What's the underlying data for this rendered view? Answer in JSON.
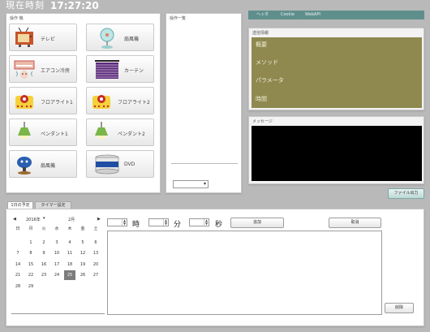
{
  "header": {
    "clock_label": "現在時刻",
    "clock_time": "17:27:20"
  },
  "devices_panel": {
    "title": "操作 機",
    "devices": [
      {
        "label": "テレビ",
        "icon": "tv-icon"
      },
      {
        "label": "扇風機",
        "icon": "fan-icon"
      },
      {
        "label": "エアコン冷房",
        "icon": "aircon-icon"
      },
      {
        "label": "カーテン",
        "icon": "curtain-icon"
      },
      {
        "label": "フロアライト1",
        "icon": "floor-lamp-icon"
      },
      {
        "label": "フロアライト2",
        "icon": "floor-lamp-icon"
      },
      {
        "label": "ペンダント1",
        "icon": "pendant-light-icon"
      },
      {
        "label": "ペンダント2",
        "icon": "pendant-light-icon"
      },
      {
        "label": "扇風機",
        "icon": "fan-robot-icon"
      },
      {
        "label": "DVD",
        "icon": "dvd-icon"
      }
    ]
  },
  "operations_panel": {
    "title": "操作一覧",
    "select_value": ""
  },
  "right_tabs": [
    {
      "label": "ヘッダ"
    },
    {
      "label": "Cookie"
    },
    {
      "label": "WebAPI"
    }
  ],
  "request_panel": {
    "title": "送信情報",
    "lines": [
      "概要",
      "メソッド",
      "パラメータ",
      "時間"
    ]
  },
  "response_panel": {
    "title": "メッセージ"
  },
  "file_output_button": "ファイル出力",
  "bottom_tabs": [
    {
      "label": "1日の予定"
    },
    {
      "label": "タイマー設定"
    }
  ],
  "calendar": {
    "year": "2016年",
    "month": "2月",
    "weekdays": [
      "日",
      "月",
      "火",
      "水",
      "木",
      "金",
      "土"
    ],
    "weeks": [
      [
        "",
        "1",
        "2",
        "3",
        "4",
        "5",
        "6"
      ],
      [
        "7",
        "8",
        "9",
        "10",
        "11",
        "12",
        "13"
      ],
      [
        "14",
        "15",
        "16",
        "17",
        "18",
        "19",
        "20"
      ],
      [
        "21",
        "22",
        "23",
        "24",
        "25",
        "26",
        "27"
      ],
      [
        "28",
        "29",
        "",
        "",
        "",
        "",
        ""
      ]
    ],
    "selected": "25",
    "prev_label": "◀",
    "next_label": "▶"
  },
  "timer": {
    "hour_label": "時",
    "minute_label": "分",
    "second_label": "秒",
    "hour_value": "",
    "minute_value": "",
    "second_value": "",
    "mid_button": "追加",
    "right_button": "取消",
    "delete_button": "削除"
  }
}
